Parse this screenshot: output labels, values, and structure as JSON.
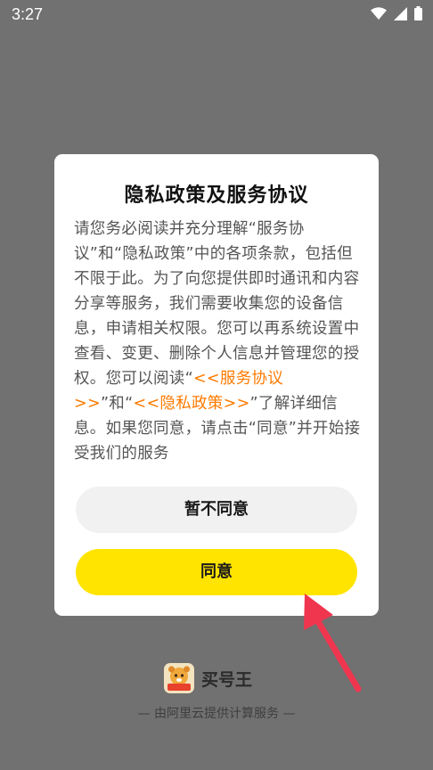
{
  "status_bar": {
    "time": "3:27",
    "icons": [
      "wifi-icon",
      "signal-icon",
      "battery-icon"
    ]
  },
  "dialog": {
    "title": "隐私政策及服务协议",
    "body": {
      "part1": "请您务必阅读并充分理解“服务协议”和“隐私政策”中的各项条款，包括但不限于此。为了向您提供即时通讯和内容分享等服务，我们需要收集您的设备信息，申请相关权限。您可以再系统设置中查看、变更、删除个人信息并管理您的授权。您可以阅读“",
      "link_service": "<<服务协议>>",
      "part2": "”和“",
      "link_privacy": "<<隐私政策>>",
      "part3": "”了解详细信息。如果您同意，请点击“同意”并开始接受我们的服务"
    },
    "disagree_label": "暂不同意",
    "agree_label": "同意"
  },
  "brand": {
    "name": "买号王",
    "logo_text": "买号王"
  },
  "footer": {
    "text": "— 由阿里云提供计算服务 —"
  },
  "colors": {
    "overlay": "#717171",
    "link": "#ff7a00",
    "agree_button": "#ffe400",
    "disagree_button": "#f1f1f1",
    "arrow": "#f0364f"
  }
}
